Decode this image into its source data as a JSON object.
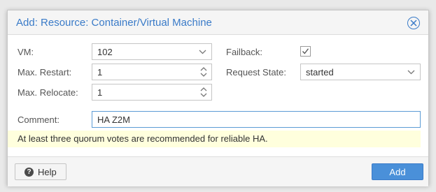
{
  "dialog": {
    "title": "Add: Resource: Container/Virtual Machine"
  },
  "form": {
    "vm": {
      "label": "VM:",
      "value": "102"
    },
    "max_restart": {
      "label": "Max. Restart:",
      "value": "1"
    },
    "max_relocate": {
      "label": "Max. Relocate:",
      "value": "1"
    },
    "failback": {
      "label": "Failback:",
      "checked": true
    },
    "request_state": {
      "label": "Request State:",
      "value": "started"
    },
    "comment": {
      "label": "Comment:",
      "value": "HA Z2M"
    }
  },
  "notice": "At least three quorum votes are recommended for reliable HA.",
  "footer": {
    "help_label": "Help",
    "add_label": "Add"
  },
  "colors": {
    "accent": "#3a7bc8",
    "primary_button": "#4a90d9",
    "notice_background": "#ffffdd"
  },
  "icons": [
    "close-icon",
    "chevron-down-icon",
    "spinner-icon",
    "checkmark-icon",
    "question-icon"
  ]
}
